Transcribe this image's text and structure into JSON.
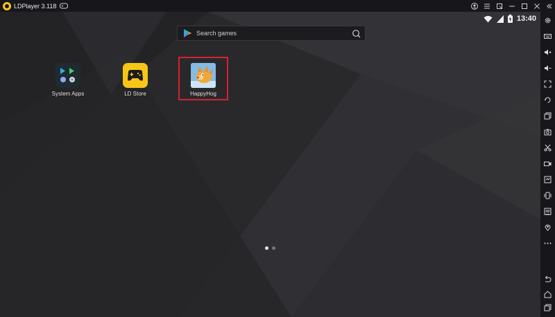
{
  "window": {
    "title": "LDPlayer 3.118"
  },
  "status_bar": {
    "time": "13:40"
  },
  "search": {
    "placeholder": "Search games"
  },
  "apps": [
    {
      "label": "System Apps",
      "icon": "system-apps-icon"
    },
    {
      "label": "LD Store",
      "icon": "ld-store-icon"
    },
    {
      "label": "HappyHog",
      "icon": "happyhog-icon"
    }
  ],
  "pager": {
    "pages": 2,
    "active": 1
  },
  "colors": {
    "titlebar": "#17171b",
    "highlight": "#d6232a",
    "ld_yellow": "#f8c516"
  },
  "sidebar_icons": [
    "settings-icon",
    "keyboard-icon",
    "volume-up-icon",
    "volume-down-icon",
    "fullscreen-icon",
    "rotate-icon",
    "multi-instance-icon",
    "screenshot-icon",
    "scissors-icon",
    "record-icon",
    "sync-icon",
    "shake-icon",
    "apk-install-icon",
    "location-icon",
    "more-icon",
    "back-icon",
    "home-icon",
    "recents-icon"
  ]
}
